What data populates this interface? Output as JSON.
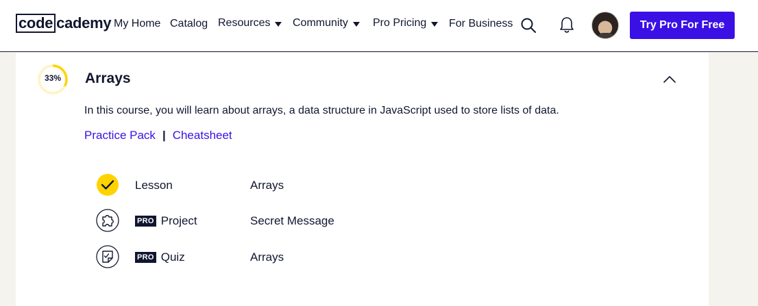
{
  "nav": {
    "logo_boxed": "code",
    "logo_rest": "cademy",
    "items": [
      {
        "label": "My Home"
      },
      {
        "label": "Catalog"
      },
      {
        "label": "Resources"
      },
      {
        "label": "Community"
      },
      {
        "label": "Pro Pricing"
      },
      {
        "label": "For Business"
      }
    ],
    "search_icon": "search-icon",
    "bell_icon": "bell-icon",
    "cta_label": "Try Pro For Free"
  },
  "module": {
    "progress_label": "33%",
    "progress_fraction": 0.33,
    "title": "Arrays",
    "description": "In this course, you will learn about arrays, a data structure in JavaScript used to store lists of data.",
    "links": [
      {
        "label": "Practice Pack"
      },
      {
        "label": "Cheatsheet"
      }
    ],
    "link_separator": "|",
    "items": [
      {
        "status_icon": "check-icon",
        "pro": false,
        "type": "Lesson",
        "name": "Arrays"
      },
      {
        "status_icon": "puzzle-icon",
        "pro": true,
        "pro_label": "PRO",
        "type": "Project",
        "name": "Secret Message"
      },
      {
        "status_icon": "quiz-icon",
        "pro": true,
        "pro_label": "PRO",
        "type": "Quiz",
        "name": "Arrays"
      }
    ]
  },
  "colors": {
    "brand_blue": "#3a10e5",
    "navy": "#10162f",
    "progress_yellow": "#ffd300",
    "background": "#f5f3ee"
  }
}
